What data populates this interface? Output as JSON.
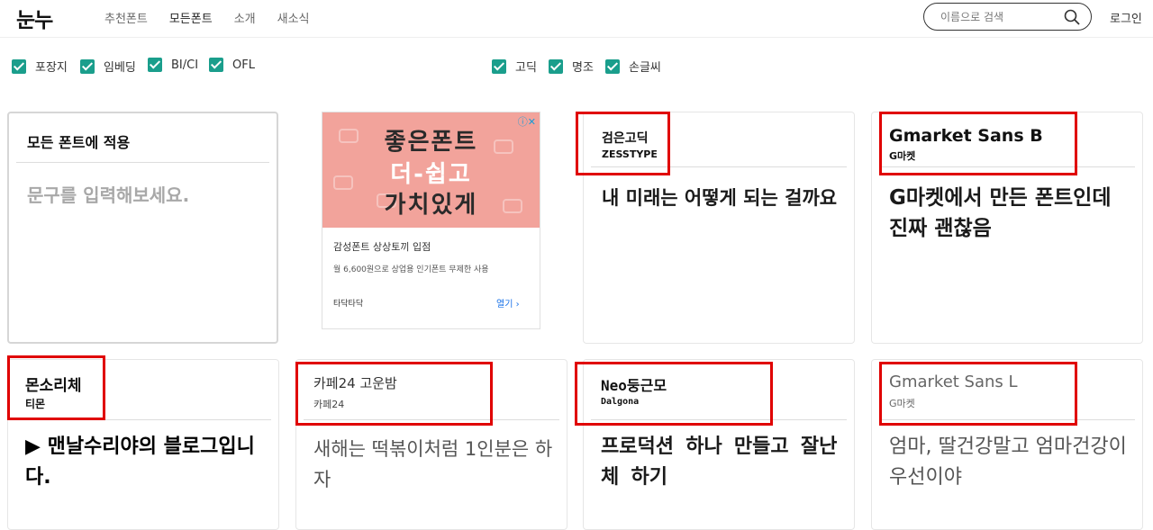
{
  "header": {
    "logo": "눈누",
    "nav": [
      "추천폰트",
      "모든폰트",
      "소개",
      "새소식"
    ],
    "search_placeholder": "이름으로 검색",
    "login": "로그인"
  },
  "filters": {
    "license": [
      "포장지",
      "임베딩",
      "BI/CI",
      "OFL"
    ],
    "style": [
      "고딕",
      "명조",
      "손글씨"
    ]
  },
  "apply_card": {
    "title": "모든 폰트에 적용",
    "placeholder": "문구를 입력해보세요."
  },
  "ad": {
    "banner_lines": [
      "좋은폰트",
      "더-쉽고",
      "가치있게"
    ],
    "title": "감성폰트 상상토끼 입점",
    "description": "월 6,600원으로 상업용 인기폰트 무제한 사용",
    "brand": "타닥타닥",
    "open_label": "열기"
  },
  "fonts": [
    {
      "name": "검은고딕",
      "maker": "ZESSTYPE",
      "sample": "내 미래는 어떻게 되는 걸까요"
    },
    {
      "name": "Gmarket Sans B",
      "maker": "G마켓",
      "sample": "G마켓에서 만든 폰트인데 진짜 괜찮음"
    },
    {
      "name": "몬소리체",
      "maker": "티몬",
      "sample": "▶ 맨날수리야의 블로그입니다."
    },
    {
      "name": "카페24 고운밤",
      "maker": "카페24",
      "sample": "새해는 떡볶이처럼 1인분은 하자"
    },
    {
      "name": "Neo둥근모",
      "maker": "Dalgona",
      "sample": "프로덕션 하나 만들고 잘난체 하기"
    },
    {
      "name": "Gmarket Sans L",
      "maker": "G마켓",
      "sample": "엄마, 딸건강말고 엄마건강이 우선이야"
    }
  ]
}
